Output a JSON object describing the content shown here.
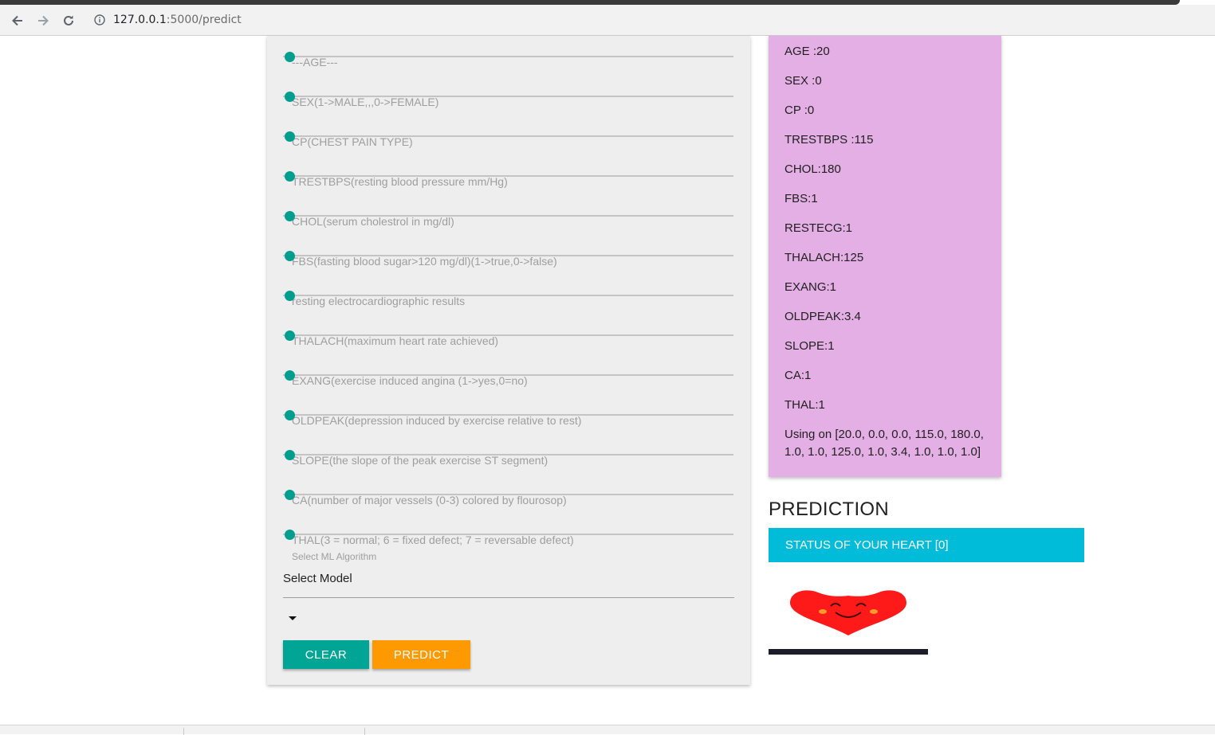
{
  "browser": {
    "url_host": "127.0.0.1",
    "url_path": ":5000/predict",
    "icons": {
      "back": "back-arrow-icon",
      "forward": "forward-arrow-icon",
      "reload": "reload-icon",
      "info": "info-icon"
    }
  },
  "form": {
    "fields": [
      {
        "placeholder": "---AGE---"
      },
      {
        "placeholder": "SEX(1->MALE,,,0->FEMALE)"
      },
      {
        "placeholder": "CP(CHEST PAIN TYPE)"
      },
      {
        "placeholder": "TRESTBPS(resting blood pressure mm/Hg)"
      },
      {
        "placeholder": "CHOL(serum cholestrol in mg/dl)"
      },
      {
        "placeholder": "FBS(fasting blood sugar>120 mg/dl)(1->true,0->false)"
      },
      {
        "placeholder": "resting electrocardiographic results"
      },
      {
        "placeholder": "THALACH(maximum heart rate achieved)"
      },
      {
        "placeholder": "EXANG(exercise induced angina (1->yes,0=no)"
      },
      {
        "placeholder": "OLDPEAK(depression induced by exercise relative to rest)"
      },
      {
        "placeholder": "SLOPE(the slope of the peak exercise ST segment)"
      },
      {
        "placeholder": "CA(number of major vessels (0-3) colored by flourosop)"
      },
      {
        "placeholder": "THAL(3 = normal; 6 = fixed defect; 7 = reversable defect)"
      }
    ],
    "algorithm_label": "Select ML Algorithm",
    "model_select": "Select Model",
    "clear_button": "CLEAR",
    "predict_button": "PREDICT"
  },
  "values": {
    "rows": [
      "AGE :20",
      "SEX :0",
      "CP :0",
      "TRESTBPS :115",
      "CHOL:180",
      "FBS:1",
      "RESTECG:1",
      "THALACH:125",
      "EXANG:1",
      "OLDPEAK:3.4",
      "SLOPE:1",
      "CA:1",
      "THAL:1"
    ],
    "using": "Using on [20.0, 0.0, 0.0, 115.0, 180.0, 1.0, 1.0, 125.0, 1.0, 3.4, 1.0, 1.0, 1.0]"
  },
  "prediction": {
    "title": "PREDICTION",
    "status": "STATUS OF YOUR HEART [0]",
    "image": "smiling-heart-image"
  },
  "colors": {
    "teal": "#00a596",
    "orange": "#ff9900",
    "values_card": "#e4afe4",
    "status_bar": "#00bcd8",
    "heart": "#ff1a1a"
  }
}
